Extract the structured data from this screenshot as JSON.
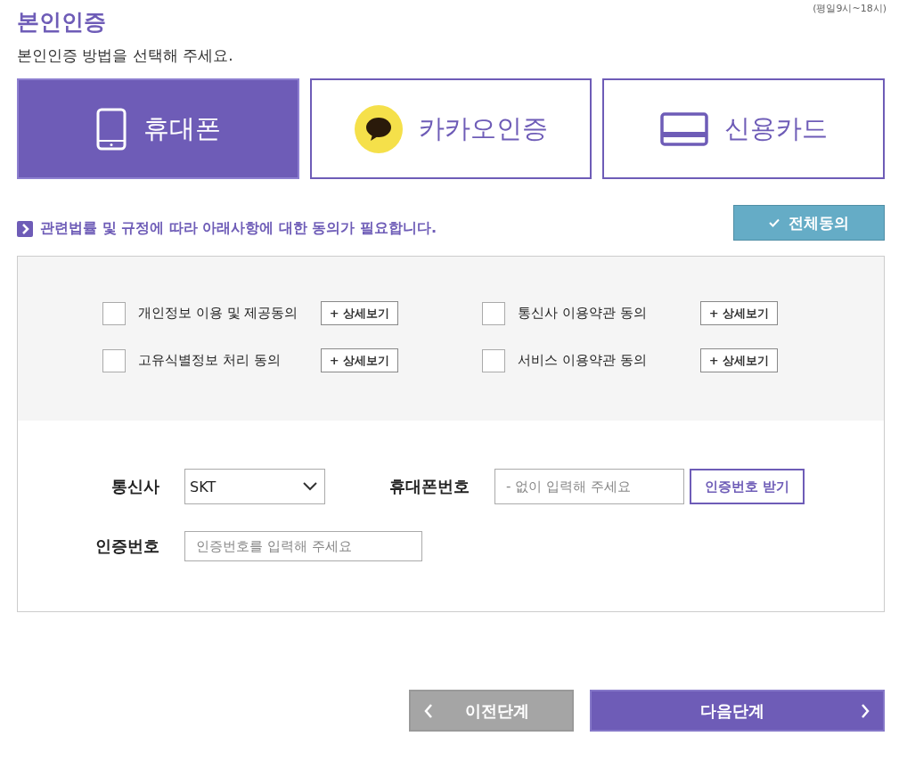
{
  "hours_note": "(평일9시~18시)",
  "title": "본인인증",
  "subtitle": "본인인증 방법을 선택해 주세요.",
  "methods": [
    {
      "kind": "phone",
      "label": "휴대폰",
      "selected": true
    },
    {
      "kind": "kakao",
      "label": "카카오인증",
      "selected": false
    },
    {
      "kind": "card",
      "label": "신용카드",
      "selected": false
    }
  ],
  "agreement_notice": "관련법률 및 규정에 따라 아래사항에 대한 동의가 필요합니다.",
  "agree_all_button": "전체동의",
  "agreements": [
    {
      "label": "개인정보 이용 및 제공동의",
      "checked": false,
      "detail_button": "+ 상세보기"
    },
    {
      "label": "통신사 이용약관 동의",
      "checked": false,
      "detail_button": "+ 상세보기"
    },
    {
      "label": "고유식별정보 처리 동의",
      "checked": false,
      "detail_button": "+ 상세보기"
    },
    {
      "label": "서비스 이용약관 동의",
      "checked": false,
      "detail_button": "+ 상세보기"
    }
  ],
  "form": {
    "carrier": {
      "label": "통신사",
      "value": "SKT"
    },
    "phone": {
      "label": "휴대폰번호",
      "placeholder": "- 없이 입력해 주세요",
      "button": "인증번호 받기"
    },
    "code": {
      "label": "인증번호",
      "placeholder": "인증번호를 입력해 주세요"
    }
  },
  "nav_buttons": [
    {
      "kind": "prev",
      "label": "이전단계"
    },
    {
      "kind": "next",
      "label": "다음단계"
    }
  ]
}
